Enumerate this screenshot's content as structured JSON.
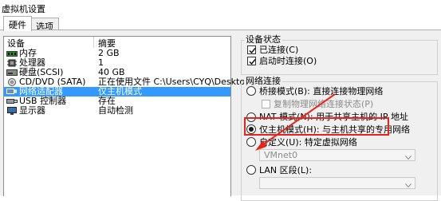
{
  "window": {
    "title": "虚拟机设置"
  },
  "tabs": [
    {
      "label": "硬件",
      "active": true
    },
    {
      "label": "选项",
      "active": false
    }
  ],
  "device_list": {
    "columns": {
      "device": "设备",
      "summary": "摘要"
    },
    "rows": [
      {
        "name": "内存",
        "summary": "2 GB",
        "icon": "memory-icon",
        "selected": false
      },
      {
        "name": "处理器",
        "summary": "1",
        "icon": "cpu-icon",
        "selected": false
      },
      {
        "name": "硬盘(SCSI)",
        "summary": "40 GB",
        "icon": "hard-disk-icon",
        "selected": false
      },
      {
        "name": "CD/DVD (SATA)",
        "summary": "正在使用文件 C:\\Users\\CYQ\\Deskto...",
        "icon": "cd-dvd-icon",
        "selected": false
      },
      {
        "name": "网络适配器",
        "summary": "仅主机模式",
        "icon": "network-adapter-icon",
        "selected": true
      },
      {
        "name": "USB 控制器",
        "summary": "存在",
        "icon": "usb-icon",
        "selected": false
      },
      {
        "name": "显示器",
        "summary": "自动检测",
        "icon": "monitor-icon",
        "selected": false
      }
    ]
  },
  "device_status": {
    "title": "设备状态",
    "connected": {
      "label": "已连接(C)",
      "checked": true
    },
    "connect_at_power_on": {
      "label": "启动时连接(O)",
      "checked": true
    }
  },
  "network_connection": {
    "title": "网络连接",
    "bridged": {
      "label": "桥接模式(B): 直接连接物理网络",
      "selected": false
    },
    "replicate": {
      "label": "复制物理网络连接状态(P)",
      "checked": false
    },
    "nat": {
      "label": "NAT 模式(N): 用于共享主机的 IP 地址",
      "selected": false
    },
    "host_only": {
      "label": "仅主机模式(H): 与主机共享的专用网络",
      "selected": true
    },
    "custom": {
      "label": "自定义(U): 特定虚拟网络",
      "selected": false
    },
    "vmnet_value": "VMnet0",
    "lan_segment": {
      "label": "LAN 区段(L):",
      "selected": false
    }
  },
  "colors": {
    "selection": "#3399ff",
    "annotation": "#e8231c",
    "panel_bg": "#f0f0f0"
  }
}
